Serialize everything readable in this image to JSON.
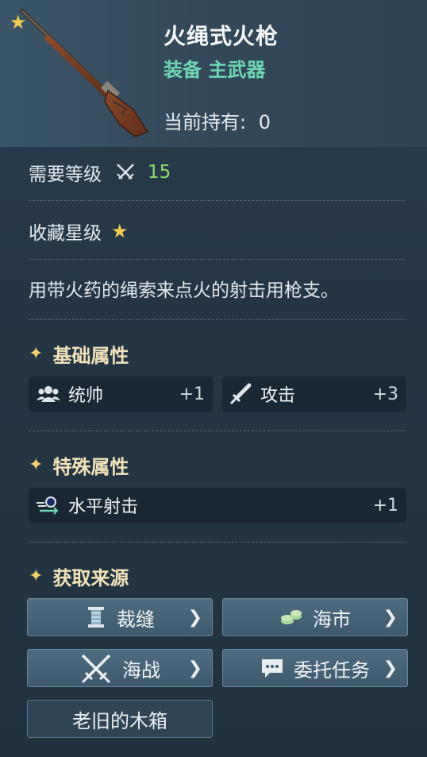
{
  "item": {
    "name": "火绳式火枪",
    "type": "装备 主武器",
    "owned_label": "当前持有",
    "owned_sep": ":",
    "owned_value": "0",
    "icon": "musket-image",
    "favorite_icon": "star-icon"
  },
  "level": {
    "label": "需要等级",
    "icon": "crossed-swords-icon",
    "value": "15"
  },
  "rarity": {
    "label": "收藏星级",
    "icon": "star-icon",
    "stars": 1
  },
  "description": "用带火药的绳索来点火的射击用枪支。",
  "base_attrs": {
    "title": "基础属性",
    "items": [
      {
        "icon": "group-icon",
        "label": "统帅",
        "value": "+1"
      },
      {
        "icon": "sword-icon",
        "label": "攻击",
        "value": "+3"
      }
    ]
  },
  "special_attrs": {
    "title": "特殊属性",
    "items": [
      {
        "icon": "horizontal-shot-icon",
        "label": "水平射击",
        "value": "+1"
      }
    ]
  },
  "sources": {
    "title": "获取来源",
    "items": [
      {
        "icon": "spool-icon",
        "label": "裁缝"
      },
      {
        "icon": "coins-icon",
        "label": "海市"
      },
      {
        "icon": "crossed-swords-icon",
        "label": "海战"
      },
      {
        "icon": "chat-icon",
        "label": "委托任务"
      }
    ],
    "extra": "老旧的木箱"
  },
  "colors": {
    "accent_green": "#6fd5b4",
    "level_green": "#8fe06c",
    "star_gold": "#f3cc4c",
    "section_title": "#f1e2b8"
  }
}
